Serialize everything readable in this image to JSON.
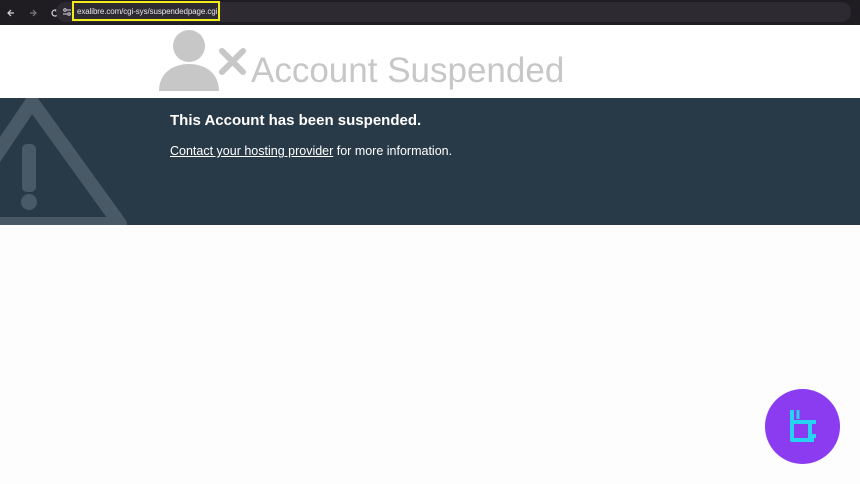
{
  "browser": {
    "url": "exalibre.com/cgi-sys/suspendedpage.cgi",
    "icons": [
      "back-arrow-icon",
      "forward-arrow-icon",
      "reload-icon",
      "site-info-icon"
    ]
  },
  "header": {
    "title": "Account Suspended",
    "icon": "user-suspended-icon"
  },
  "banner": {
    "heading": "This Account has been suspended.",
    "link_text": "Contact your hosting provider",
    "trailing_text": " for more information.",
    "icon": "warning-triangle-icon"
  },
  "colors": {
    "banner_bg": "#283a48",
    "title_gray": "#c7c7c7",
    "url_highlight": "#f1ec1a",
    "logo_purple": "#8b3cf0",
    "logo_cyan": "#27d3f3"
  }
}
